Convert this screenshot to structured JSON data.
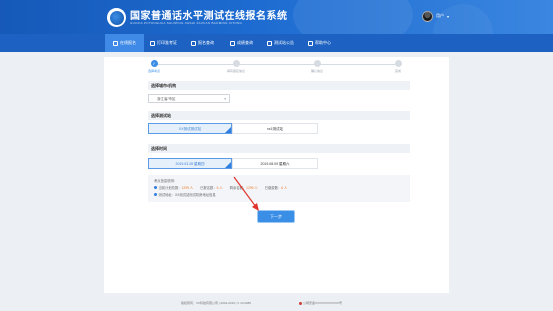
{
  "header": {
    "title": "国家普通话水平测试在线报名系统",
    "subtitle": "GUOJIA PUTONGHUA SHUIPING CESHI ZAIXIAN BAOMING XITONG",
    "user_name": "用户"
  },
  "nav": {
    "items": [
      {
        "label": "在线报名"
      },
      {
        "label": "打印准考证"
      },
      {
        "label": "报名查询"
      },
      {
        "label": "成绩查询"
      },
      {
        "label": "测试站公告"
      },
      {
        "label": "帮助中心"
      }
    ],
    "active_index": 0
  },
  "steps": [
    {
      "label": "选择考点"
    },
    {
      "label": "填写报名信息"
    },
    {
      "label": "确认信息"
    },
    {
      "label": "完成"
    }
  ],
  "sections": {
    "city": {
      "title": "选择城市/机构",
      "value": "浙江省/市区",
      "caret": "▾"
    },
    "station": {
      "title": "选择测试站",
      "options": [
        "XX测试测试站",
        "xx1测试站"
      ]
    },
    "time": {
      "title": "选择时间",
      "options": [
        "2019.03.28 星期四",
        "2019.08.09 星期六"
      ]
    }
  },
  "info": {
    "heading": "考点信息说明：",
    "row1": [
      {
        "label": "当前计划总数：",
        "value": "1299 人"
      },
      {
        "label": "已报名数：",
        "value": "6 人"
      },
      {
        "label": "剩余名额：",
        "value": "1299 人"
      },
      {
        "label": "已缴费数：",
        "value": "6 人"
      }
    ],
    "row2": "测试地址：XX测试站测试机房地址信息"
  },
  "next_button": "下一步",
  "footer": {
    "copyright": "版权所有：XX科技有限公司 | 2004-2019 | V 10.0080",
    "icp": "公网安备XXXXXXXXXXXX号"
  },
  "colors": {
    "primary": "#3a8ee6",
    "header": "#1d62c2",
    "accent": "#f07b2b"
  }
}
